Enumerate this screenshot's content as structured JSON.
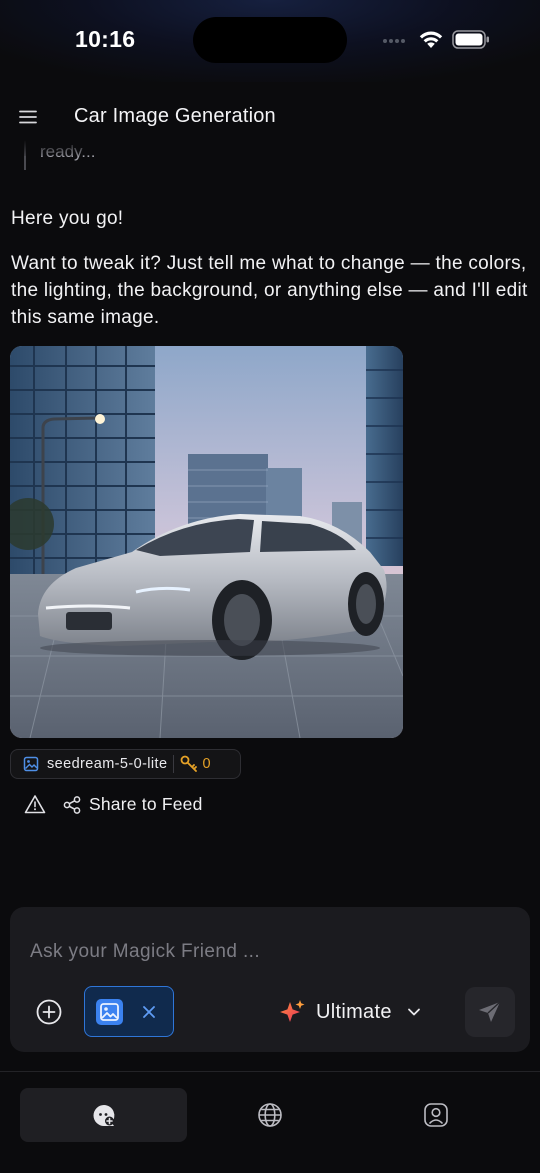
{
  "status_bar": {
    "time": "10:16"
  },
  "header": {
    "title": "Car Image Generation",
    "menu_icon": "hamburger-menu-icon"
  },
  "chat": {
    "previous_fragment": "ready...",
    "reply_intro": "Here you go!",
    "reply_body": "Want to tweak it? Just tell me what to change — the colors, the lighting, the background, or anything else — and I'll edit this same image.",
    "image_alt": "Silver electric sedan parked on a plaza among glass skyscrapers at dusk",
    "model_chip": {
      "model": "seedream-5-0-lite",
      "key_count": "0",
      "icon": "image-icon",
      "key_icon": "key-icon"
    },
    "actions": {
      "report_icon": "warning-icon",
      "share_label": "Share to Feed",
      "share_icon": "share-icon"
    }
  },
  "composer": {
    "placeholder": "Ask your Magick Friend ...",
    "attachment_icon": "image-icon",
    "model_label": "Ultimate",
    "send_icon": "send-icon"
  },
  "bottom_nav": {
    "tabs": [
      {
        "name": "chat",
        "icon": "chat-icon",
        "active": true
      },
      {
        "name": "explore",
        "icon": "globe-icon",
        "active": false
      },
      {
        "name": "profile",
        "icon": "profile-icon",
        "active": false
      }
    ]
  },
  "colors": {
    "background": "#0b0b0d",
    "composer_bg": "#1b1b1f",
    "accent_blue": "#2f76d8",
    "key_gold": "#e6a227"
  }
}
